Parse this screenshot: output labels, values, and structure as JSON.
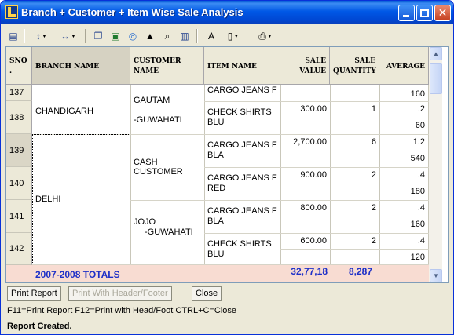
{
  "window": {
    "title": "Branch + Customer + Item Wise Sale Analysis"
  },
  "colors": {
    "title_bar": "#0058e6",
    "totals_text": "#1e30c8",
    "totals_bg": "#f8dcd2"
  },
  "toolbar": {
    "icons": [
      "print-setup-icon",
      "sort-icon",
      "column-width-icon",
      "copy-icon",
      "excel-icon",
      "browser-icon",
      "up-arrow-icon",
      "find-icon",
      "chart-icon",
      "font-icon",
      "print-preview-icon",
      "printer-icon"
    ]
  },
  "table": {
    "headers": {
      "sno": "SNO",
      "sno_dot": ".",
      "branch": "BRANCH NAME",
      "customer_1": "CUSTOMER",
      "customer_2": "NAME",
      "item": "ITEM NAME",
      "sale_value_1": "SALE",
      "sale_value_2": "VALUE",
      "sale_qty_1": "SALE",
      "sale_qty_2": "QUANTITY",
      "average": "AVERAGE"
    },
    "row_numbers": [
      "137",
      "138",
      "139",
      "140",
      "141",
      "142"
    ],
    "branches": [
      "CHANDIGARH",
      "DELHI"
    ],
    "customers": {
      "gautam": "GAUTAM",
      "gautam_city": "-GUWAHATI",
      "cash_1": "CASH",
      "cash_2": "CUSTOMER",
      "jojo_1": "JOJO",
      "jojo_2": "-GUWAHATI"
    },
    "items": {
      "i1": "CARGO JEANS F",
      "i2a": "CHECK SHIRTS",
      "i2b": "BLU",
      "i3a": "CARGO JEANS F",
      "i3b": "BLA",
      "i4a": "CARGO JEANS F",
      "i4b": "RED",
      "i5a": "CARGO JEANS F",
      "i5b": "BLA",
      "i6a": "CHECK SHIRTS",
      "i6b": "BLU"
    },
    "values": {
      "v2": "300.00",
      "q2": "1",
      "v3": "2,700.00",
      "q3": "6",
      "v4": "900.00",
      "q4": "2",
      "v5": "800.00",
      "q5": "2",
      "v6": "600.00",
      "q6": "2"
    },
    "averages": [
      "160",
      ".2",
      "60",
      "1.2",
      "540",
      ".4",
      "180",
      ".4",
      "160",
      ".4",
      "120"
    ],
    "totals": {
      "label": "2007-2008 TOTALS",
      "sale_value": "32,77,18",
      "sale_quantity": "8,287"
    }
  },
  "buttons": {
    "print_report": "Print Report",
    "print_header_footer": "Print With Header/Footer",
    "close": "Close"
  },
  "hint": "F11=Print Report  F12=Print with Head/Foot  CTRL+C=Close",
  "status": "Report Created."
}
